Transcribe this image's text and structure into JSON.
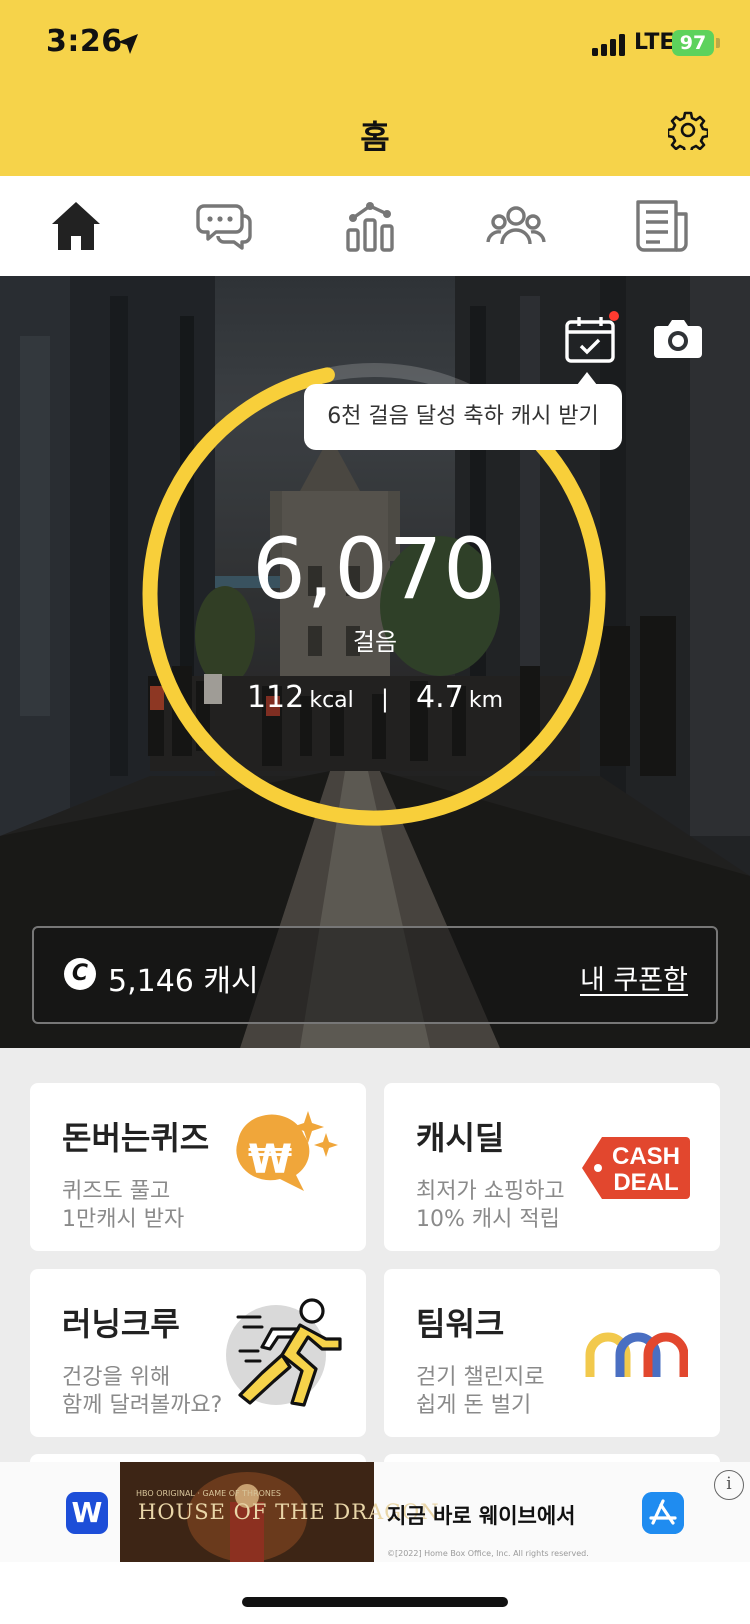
{
  "status_bar": {
    "time": "3:26",
    "network": "LTE",
    "battery": "97"
  },
  "header": {
    "title": "홈"
  },
  "tabs": [
    {
      "icon": "home-icon"
    },
    {
      "icon": "chat-bubbles-icon"
    },
    {
      "icon": "stats-chart-icon"
    },
    {
      "icon": "group-icon"
    },
    {
      "icon": "news-icon"
    }
  ],
  "hero": {
    "tooltip": "6천 걸음 달성 축하 캐시 받기",
    "steps": "6,070",
    "steps_label": "걸음",
    "kcal_value": "112",
    "kcal_unit": "kcal",
    "separator": "|",
    "distance_value": "4.7",
    "distance_unit": "km",
    "progress_fraction": 0.85,
    "coin_symbol": "C",
    "cash_amount": "5,146 캐시",
    "coupon_link": "내 쿠폰함"
  },
  "cards": [
    {
      "title": "돈버는퀴즈",
      "line1": "퀴즈도 풀고",
      "line2": "1만캐시 받자"
    },
    {
      "title": "캐시딜",
      "line1": "최저가 쇼핑하고",
      "line2": "10% 캐시 적립",
      "badge_line1": "CASH",
      "badge_line2": "DEAL"
    },
    {
      "title": "러닝크루",
      "line1": "건강을 위해",
      "line2": "함께 달려볼까요?"
    },
    {
      "title": "팀워크",
      "line1": "걷기 챌린지로",
      "line2": "쉽게 돈 벌기"
    }
  ],
  "ad": {
    "app_letter": "W",
    "image_title": "HOUSE OF THE DRAGON",
    "image_subtitle": "HBO ORIGINAL · GAME OF THRONES",
    "text": "지금 바로 웨이브에서",
    "copyright": "©[2022] Home Box Office, Inc. All rights reserved.",
    "info": "i"
  },
  "colors": {
    "brand_yellow": "#f6d34a",
    "ring_yellow": "#f8cf3a",
    "cash_deal_red": "#e2472e",
    "quiz_orange": "#f0a63a"
  }
}
